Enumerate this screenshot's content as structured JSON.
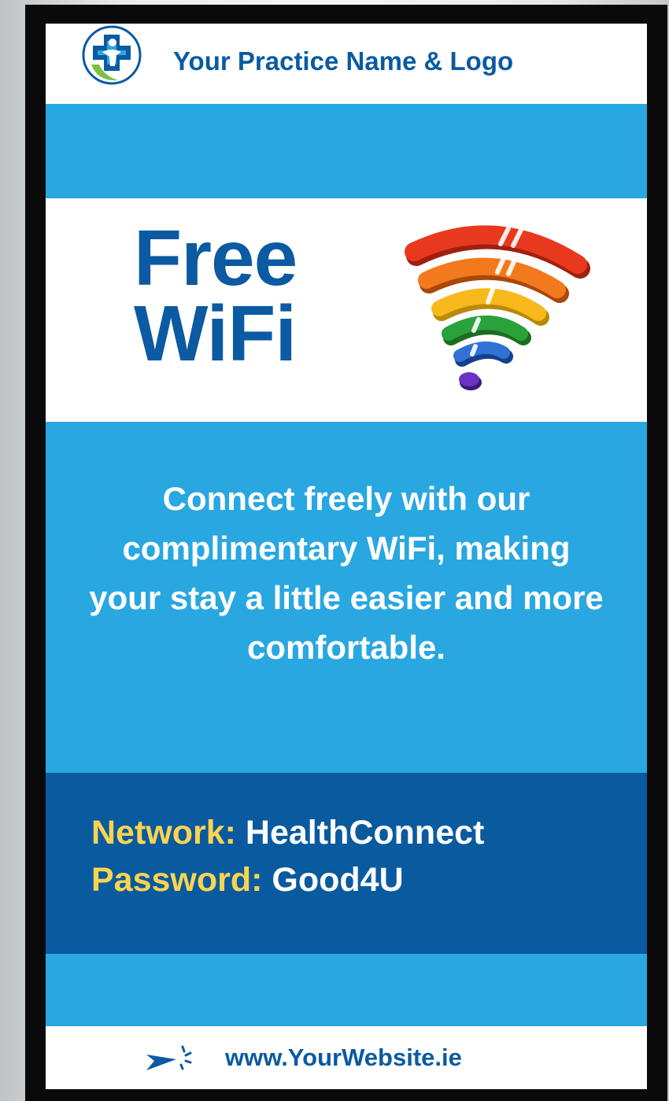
{
  "header": {
    "practice_name": "Your Practice Name & Logo",
    "logo_icon": "medical-figure-logo-icon"
  },
  "hero": {
    "title_line1": "Free",
    "title_line2": "WiFi",
    "wifi_icon": "rainbow-wifi-icon"
  },
  "message": {
    "text": "Connect freely with our complimentary WiFi, making your stay a little easier and more comfortable."
  },
  "credentials": {
    "network_label": "Network:",
    "network_value": "HealthConnect",
    "password_label": "Password:",
    "password_value": "Good4U"
  },
  "footer": {
    "website": "www.YourWebsite.ie",
    "cursor_icon": "click-cursor-icon"
  },
  "colors": {
    "dark_blue": "#0b5aa2",
    "light_blue": "#29a7e1",
    "navy_band": "#0a5aa0",
    "yellow": "#fbd44f",
    "white": "#ffffff"
  }
}
